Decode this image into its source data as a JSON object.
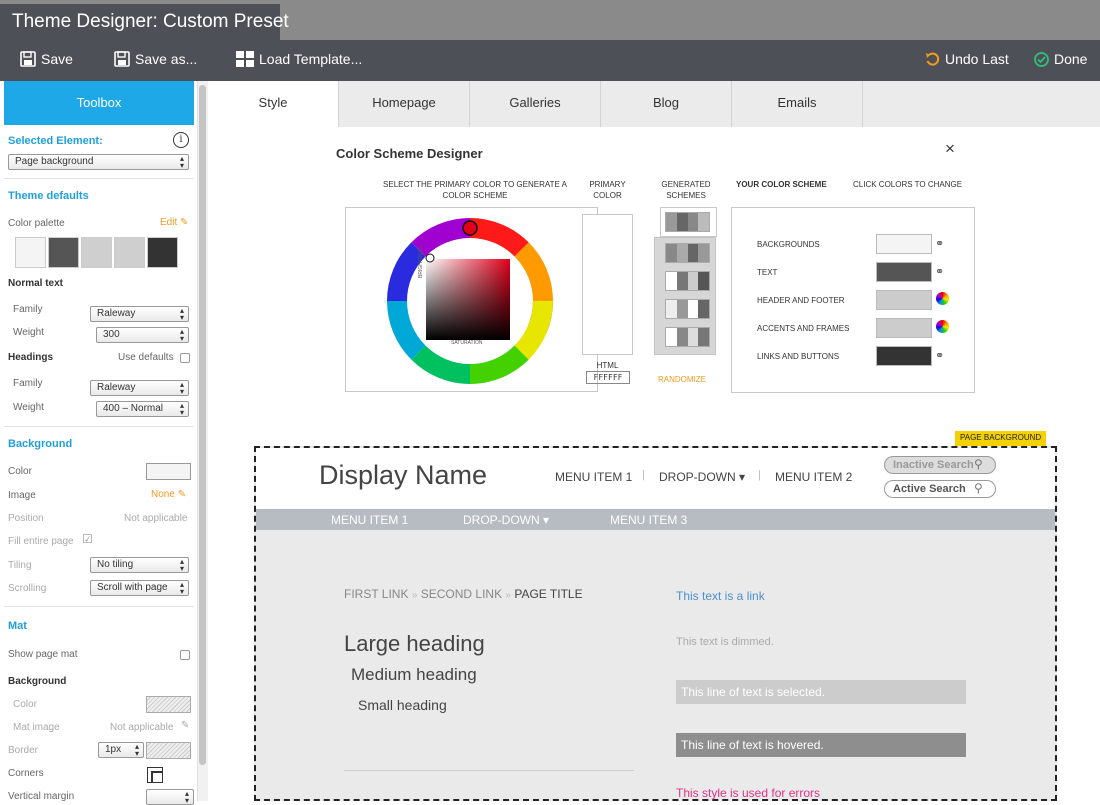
{
  "window": {
    "title": "Theme Designer:  Custom Preset"
  },
  "toolbar": {
    "save": "Save",
    "save_as": "Save as...",
    "load_template": "Load Template...",
    "undo": "Undo Last",
    "done": "Done"
  },
  "sidebar": {
    "toolbox": "Toolbox",
    "selected_element_label": "Selected Element:",
    "selected_element_value": "Page background",
    "theme_defaults": "Theme defaults",
    "color_palette": "Color palette",
    "edit": "Edit",
    "palette_colors": [
      "#f4f4f4",
      "#555555",
      "#cfcfcf",
      "#cfcfcf",
      "#333333"
    ],
    "normal_text": "Normal text",
    "family": "Family",
    "weight": "Weight",
    "normal_family": "Raleway",
    "normal_weight": "300",
    "headings": "Headings",
    "use_defaults": "Use defaults",
    "headings_family": "Raleway",
    "headings_weight": "400 – Normal",
    "background": "Background",
    "color": "Color",
    "image": "Image",
    "image_value": "None",
    "position": "Position",
    "not_applicable": "Not applicable",
    "fill_entire_page": "Fill entire page",
    "tiling": "Tiling",
    "tiling_value": "No tiling",
    "scrolling": "Scrolling",
    "scrolling_value": "Scroll with page",
    "mat": "Mat",
    "show_page_mat": "Show page mat",
    "mat_background": "Background",
    "mat_color": "Color",
    "mat_image": "Mat image",
    "border": "Border",
    "border_value": "1px",
    "corners": "Corners",
    "vertical_margin": "Vertical margin"
  },
  "tabs": [
    "Style",
    "Homepage",
    "Galleries",
    "Blog",
    "Emails"
  ],
  "designer": {
    "title": "Color Scheme Designer",
    "close": "×",
    "select_primary": "SELECT THE PRIMARY COLOR TO GENERATE A COLOR SCHEME",
    "primary_color": "PRIMARY COLOR",
    "generated": "GENERATED SCHEMES",
    "your_scheme": "YOUR COLOR SCHEME",
    "click_colors": "CLICK COLORS TO CHANGE",
    "brightness": "BRIGHTNESS",
    "saturation": "SATURATION",
    "html_label": "HTML",
    "html_value": "FFFFFF",
    "randomize": "RANDOMIZE",
    "scheme_rows": [
      {
        "label": "BACKGROUNDS",
        "color": "#f4f4f4"
      },
      {
        "label": "TEXT",
        "color": "#555555"
      },
      {
        "label": "HEADER AND FOOTER",
        "color": "#cccccc"
      },
      {
        "label": "ACCENTS AND FRAMES",
        "color": "#cccccc"
      },
      {
        "label": "LINKS AND BUTTONS",
        "color": "#333333"
      }
    ]
  },
  "preview": {
    "badge": "PAGE BACKGROUND",
    "display_name": "Display Name",
    "menu_item_1": "MENU ITEM 1",
    "dropdown": "DROP-DOWN ▾",
    "menu_item_2": "MENU ITEM 2",
    "inactive_search": "Inactive Search",
    "active_search": "Active Search",
    "nav_menu_1": "MENU ITEM 1",
    "nav_dropdown": "DROP-DOWN ▾",
    "nav_menu_3": "MENU ITEM 3",
    "crumb_1": "FIRST LINK",
    "crumb_2": "SECOND LINK",
    "crumb_3": "PAGE TITLE",
    "large_heading": "Large heading",
    "medium_heading": "Medium heading",
    "small_heading": "Small heading",
    "link_text": "This text is a link",
    "dimmed_text": "This text is dimmed.",
    "selected_text": "This line of text is selected.",
    "hovered_text": "This line of text is hovered.",
    "error_text": "This style is used for errors"
  }
}
